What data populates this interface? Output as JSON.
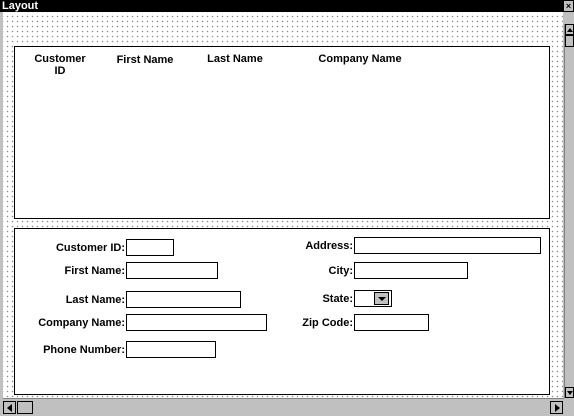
{
  "window": {
    "title": "Layout",
    "close_glyph": "×"
  },
  "list": {
    "columns": [
      {
        "label": "Customer\nID"
      },
      {
        "label": "First Name"
      },
      {
        "label": "Last Name"
      },
      {
        "label": "Company Name"
      }
    ]
  },
  "form": {
    "customer_id": {
      "label": "Customer ID:",
      "value": ""
    },
    "first_name": {
      "label": "First Name:",
      "value": ""
    },
    "last_name": {
      "label": "Last Name:",
      "value": ""
    },
    "company_name": {
      "label": "Company Name:",
      "value": ""
    },
    "phone_number": {
      "label": "Phone Number:",
      "value": ""
    },
    "address": {
      "label": "Address:",
      "value": ""
    },
    "city": {
      "label": "City:",
      "value": ""
    },
    "state": {
      "label": "State:",
      "value": ""
    },
    "zip_code": {
      "label": "Zip Code:",
      "value": ""
    }
  },
  "icons": {
    "dropdown": "chevron-down-icon",
    "scroll_up": "arrow-up-icon",
    "scroll_down": "arrow-down-icon",
    "scroll_left": "arrow-left-icon",
    "scroll_right": "arrow-right-icon"
  }
}
